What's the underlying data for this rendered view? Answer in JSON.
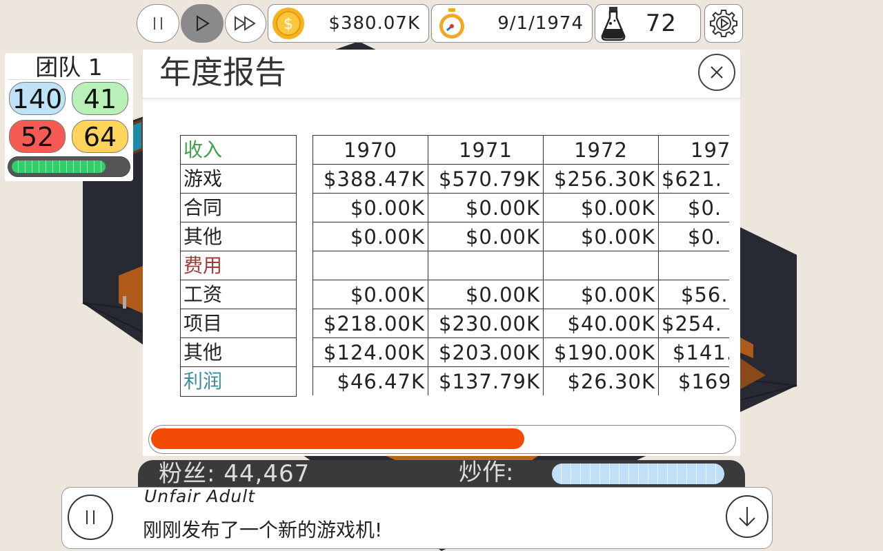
{
  "colors": {
    "income": "#3ea34a",
    "expenses": "#a33a34",
    "profit": "#3a8f9a",
    "progress": "#f44a06",
    "stat_blue": "#bfe2f7",
    "stat_green": "#b9f0b8",
    "stat_red": "#f65a55",
    "stat_yellow": "#ffd45a"
  },
  "topbar": {
    "money": "$380.07K",
    "date": "9/1/1974",
    "research": "72"
  },
  "team": {
    "title": "团队 1",
    "stat_design": "140",
    "stat_tech": "41",
    "stat_bugs": "52",
    "stat_research": "64",
    "progress": 0.82
  },
  "report": {
    "title": "年度报告",
    "labels": {
      "income": "收入",
      "games": "游戏",
      "contracts": "合同",
      "other_income": "其他",
      "expenses": "费用",
      "salaries": "工资",
      "projects": "项目",
      "other_expenses": "其他",
      "profit": "利润"
    },
    "years": [
      {
        "year": "1970",
        "games": "$388.47K",
        "contracts": "$0.00K",
        "other_income": "$0.00K",
        "salaries": "$0.00K",
        "projects": "$218.00K",
        "other_expenses": "$124.00K",
        "profit": "$46.47K"
      },
      {
        "year": "1971",
        "games": "$570.79K",
        "contracts": "$0.00K",
        "other_income": "$0.00K",
        "salaries": "$0.00K",
        "projects": "$230.00K",
        "other_expenses": "$203.00K",
        "profit": "$137.79K"
      },
      {
        "year": "1972",
        "games": "$256.30K",
        "contracts": "$0.00K",
        "other_income": "$0.00K",
        "salaries": "$0.00K",
        "projects": "$40.00K",
        "other_expenses": "$190.00K",
        "profit": "$26.30K"
      },
      {
        "year": "197",
        "games": "$621.",
        "contracts": "$0.",
        "other_income": "$0.",
        "salaries": "$56.",
        "projects": "$254.",
        "other_expenses": "$141.",
        "profit": "$169"
      }
    ],
    "scroll_progress": 0.64
  },
  "fans": {
    "label": "粉丝: 44,467",
    "hype_label": "炒作:",
    "hype_level": 1.0
  },
  "news": {
    "title": "Unfair Adult",
    "message": "刚刚发布了一个新的游戏机!"
  }
}
